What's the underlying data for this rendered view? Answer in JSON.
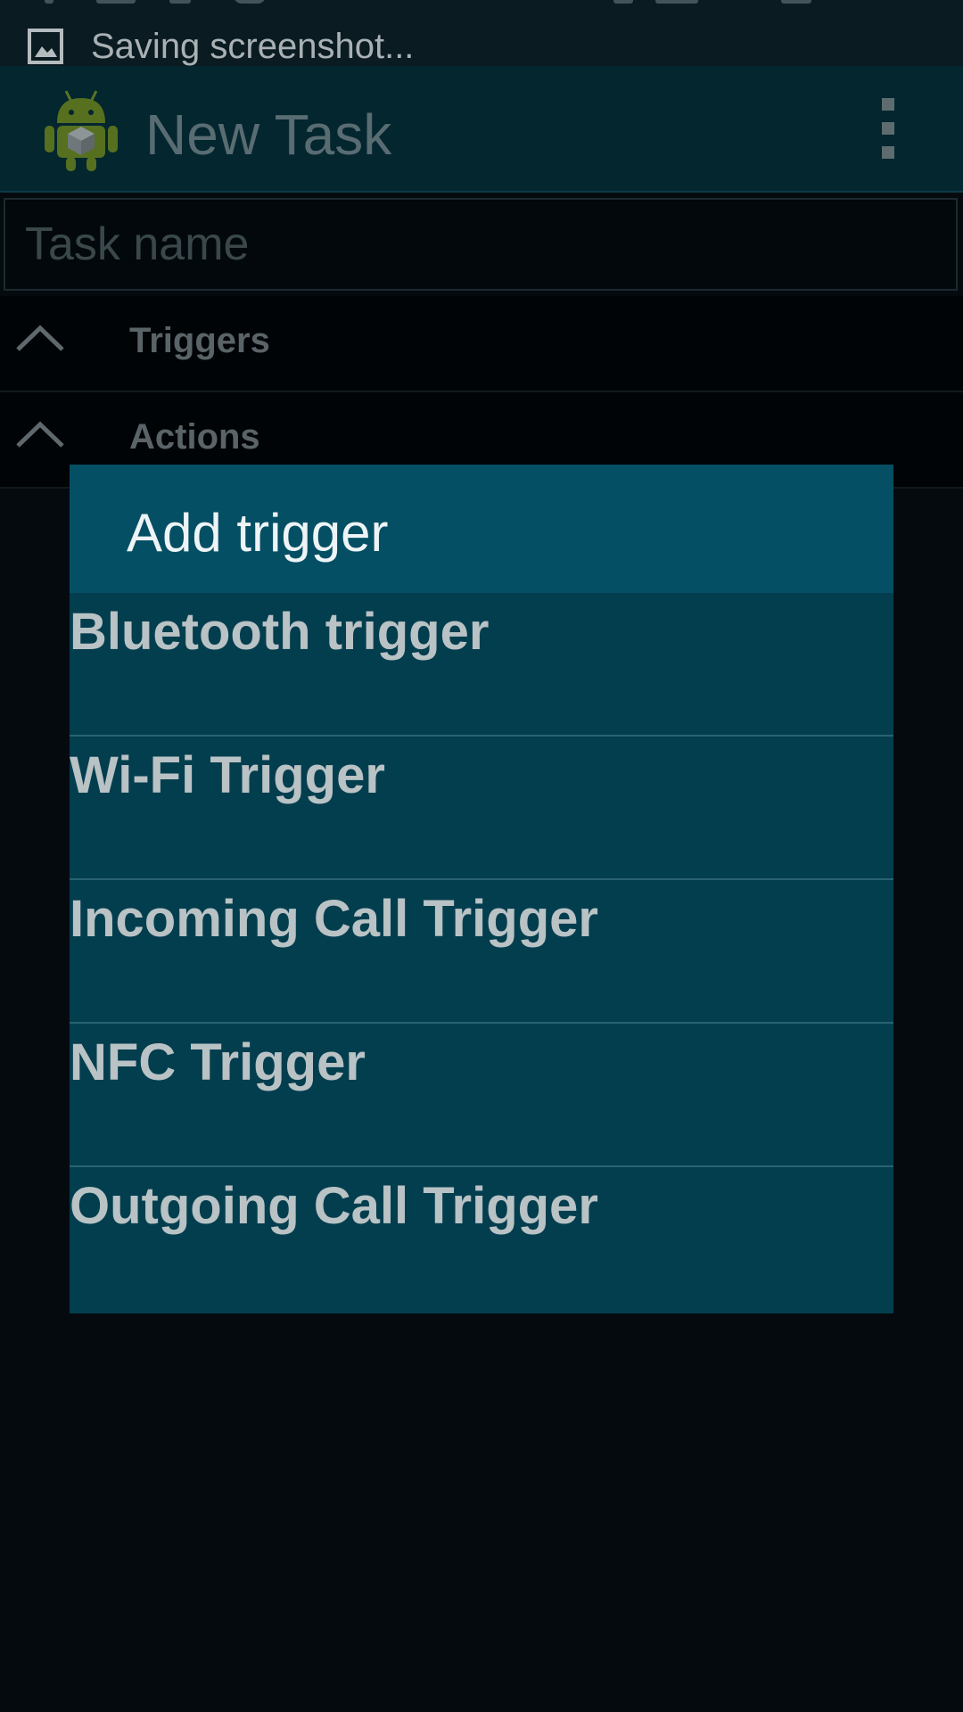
{
  "status_bar": {
    "notification_icon": "screenshot-icon",
    "notification_text": "Saving screenshot..."
  },
  "action_bar": {
    "app_icon": "android-app-icon",
    "title": "New Task",
    "menu_icon": "overflow-menu-icon"
  },
  "form": {
    "task_name": {
      "value": "",
      "placeholder": "Task name"
    },
    "sections": [
      {
        "label": "Triggers",
        "icon": "chevron-up-icon"
      },
      {
        "label": "Actions",
        "icon": "chevron-up-icon"
      }
    ]
  },
  "dialog": {
    "title": "Add trigger",
    "items": [
      {
        "label": "Bluetooth trigger"
      },
      {
        "label": "Wi-Fi Trigger"
      },
      {
        "label": "Incoming Call Trigger"
      },
      {
        "label": "NFC Trigger"
      },
      {
        "label": "Outgoing Call Trigger"
      }
    ]
  },
  "colors": {
    "status_bar_bg": "#0a1b21",
    "action_bar_bg": "#03262f",
    "dialog_header_bg": "#044f63",
    "dialog_body_bg": "#033e4f",
    "screen_bg": "#050a0e"
  }
}
